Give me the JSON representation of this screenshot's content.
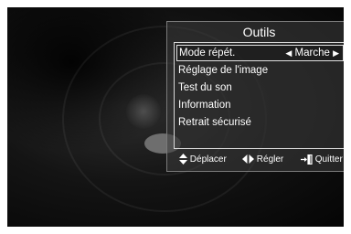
{
  "menu": {
    "title": "Outils",
    "items": [
      {
        "label": "Mode répét.",
        "value": "Marche",
        "selected": true
      },
      {
        "label": "Réglage de l'image"
      },
      {
        "label": "Test du son"
      },
      {
        "label": "Information"
      },
      {
        "label": "Retrait sécurisé"
      }
    ]
  },
  "footer": {
    "move_label": "Déplacer",
    "adjust_label": "Régler",
    "exit_label": "Quitter"
  },
  "colors": {
    "panel_border": "#7a7a7a",
    "selection_border": "#e0e0e0",
    "text": "#ffffff"
  }
}
